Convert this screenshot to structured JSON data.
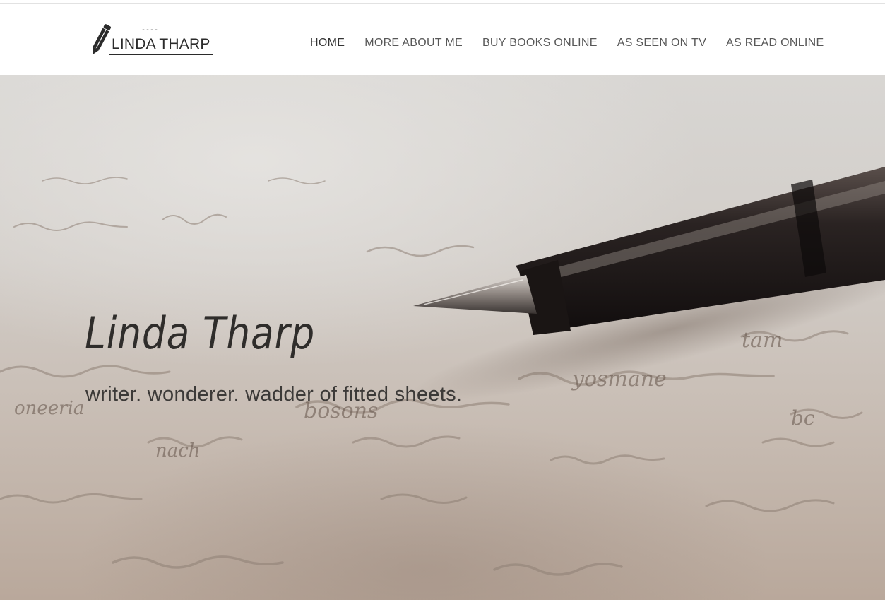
{
  "site": {
    "logo_text": "LINDA THARP",
    "logo_mark": "pencil-icon"
  },
  "nav": {
    "items": [
      {
        "label": "HOME",
        "active": true
      },
      {
        "label": "MORE ABOUT ME",
        "active": false
      },
      {
        "label": "BUY BOOKS ONLINE",
        "active": false
      },
      {
        "label": "AS SEEN ON TV",
        "active": false
      },
      {
        "label": "AS READ ONLINE",
        "active": false
      }
    ]
  },
  "hero": {
    "title": "Linda Tharp",
    "subtitle": "writer. wonderer. wadder of fitted sheets.",
    "background_image": "fountain-pen-on-handwritten-letter"
  },
  "colors": {
    "text_dark": "#2f2d2b",
    "nav_text": "#585858",
    "header_bg": "#ffffff",
    "hero_tone": "#c8bdb4"
  }
}
